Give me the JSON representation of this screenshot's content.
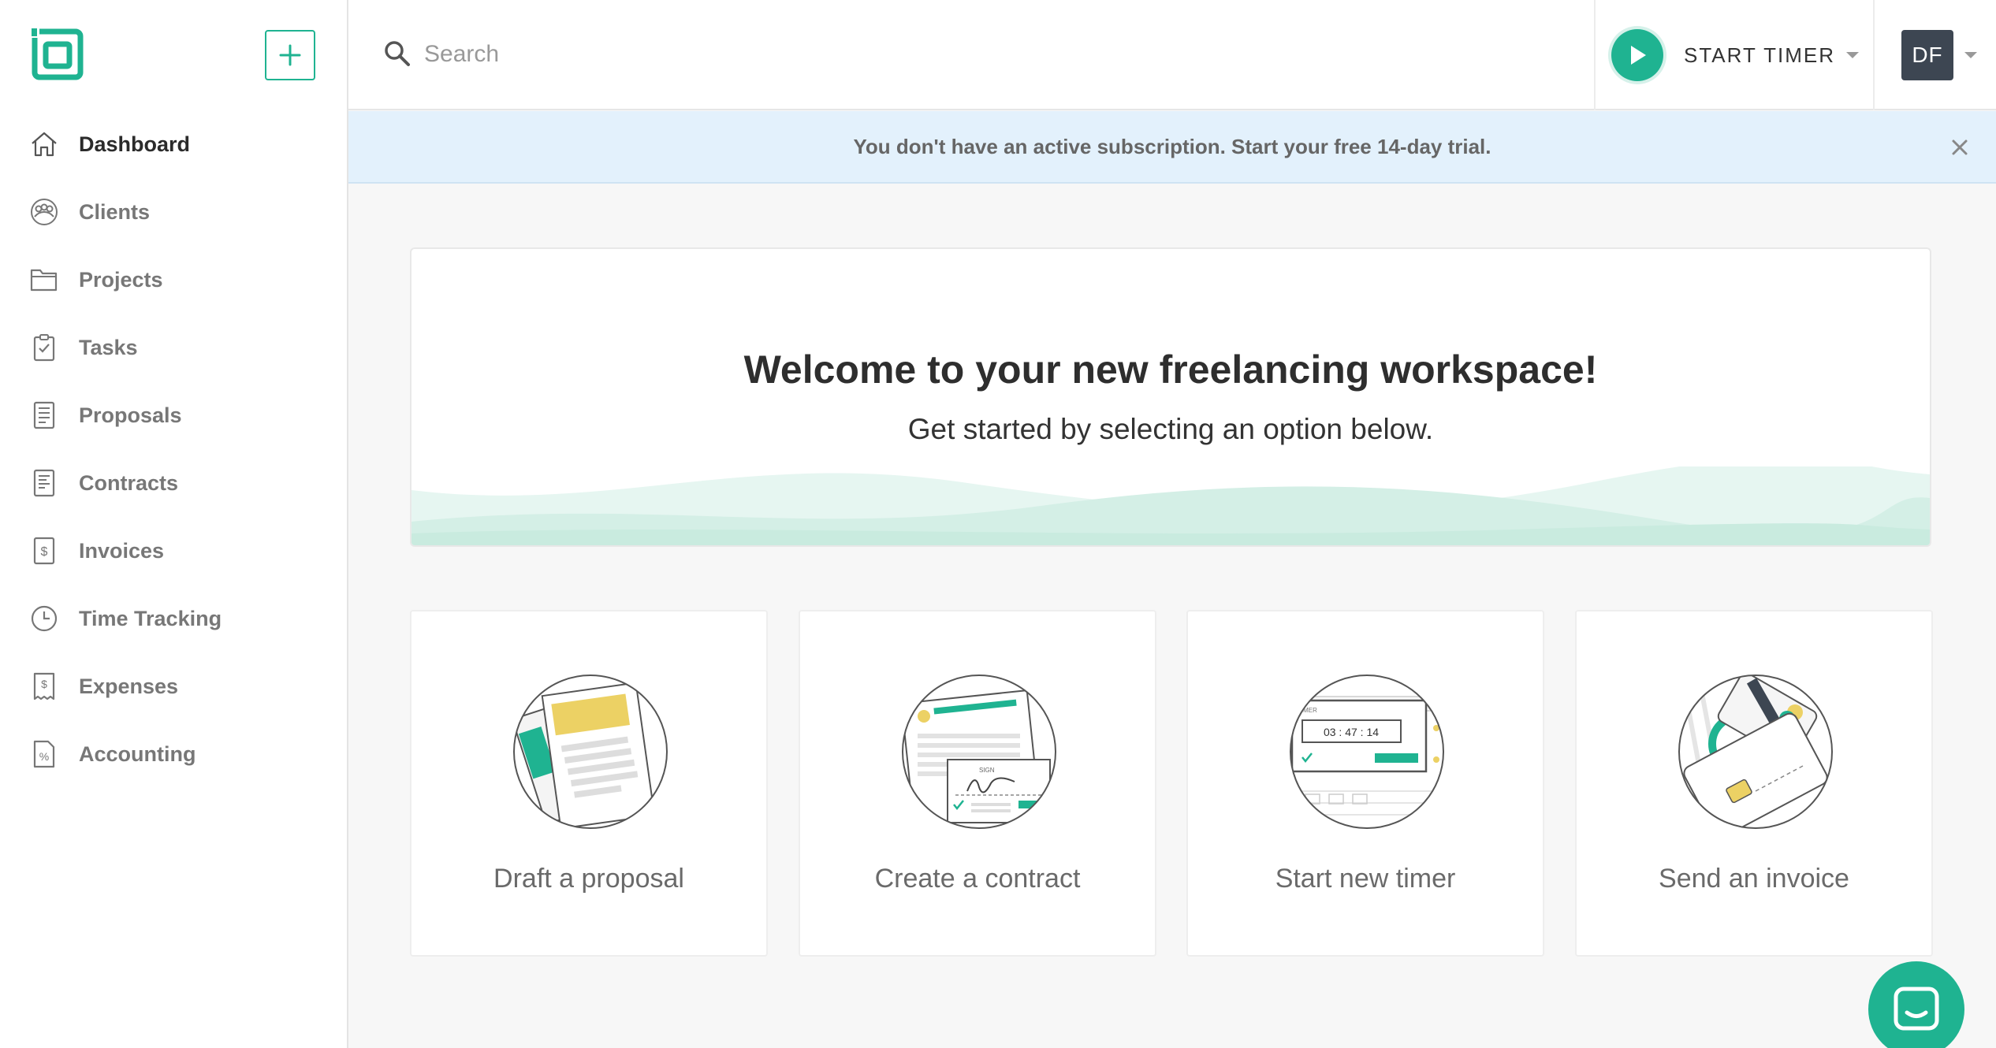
{
  "sidebar": {
    "logo_icon": "bonsai-logo-icon",
    "add_button_icon": "plus-icon",
    "items": [
      {
        "label": "Dashboard",
        "icon": "home-icon",
        "active": true
      },
      {
        "label": "Clients",
        "icon": "clients-icon",
        "active": false
      },
      {
        "label": "Projects",
        "icon": "folder-icon",
        "active": false
      },
      {
        "label": "Tasks",
        "icon": "clipboard-check-icon",
        "active": false
      },
      {
        "label": "Proposals",
        "icon": "proposal-doc-icon",
        "active": false
      },
      {
        "label": "Contracts",
        "icon": "contract-doc-icon",
        "active": false
      },
      {
        "label": "Invoices",
        "icon": "invoice-dollar-icon",
        "active": false
      },
      {
        "label": "Time Tracking",
        "icon": "clock-icon",
        "active": false
      },
      {
        "label": "Expenses",
        "icon": "receipt-icon",
        "active": false
      },
      {
        "label": "Accounting",
        "icon": "percent-doc-icon",
        "active": false
      }
    ]
  },
  "header": {
    "search": {
      "placeholder": "Search",
      "value": ""
    },
    "timer": {
      "label": "START TIMER"
    },
    "avatar": {
      "initials": "DF"
    }
  },
  "banner": {
    "text": "You don't have an active subscription. Start your free 14-day trial."
  },
  "welcome": {
    "title": "Welcome to your new freelancing workspace!",
    "subtitle": "Get started by selecting an option below."
  },
  "actions": [
    {
      "label": "Draft a proposal",
      "icon": "proposal-illustration-icon"
    },
    {
      "label": "Create a contract",
      "icon": "contract-illustration-icon"
    },
    {
      "label": "Start new timer",
      "icon": "timer-illustration-icon",
      "timer_text": "03 : 47 : 14",
      "timer_caption": "TIMER"
    },
    {
      "label": "Send an invoice",
      "icon": "invoice-card-illustration-icon"
    }
  ],
  "colors": {
    "accent": "#1fb391",
    "banner_bg": "#e3f1fc",
    "avatar_bg": "#3d4652",
    "illustration_yellow": "#ecd164"
  }
}
